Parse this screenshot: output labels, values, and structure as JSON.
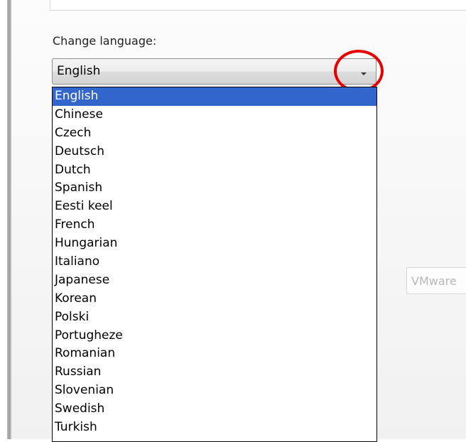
{
  "language_label": "Change language:",
  "combo": {
    "selected": "English"
  },
  "options": [
    "English",
    "Chinese",
    "Czech",
    "Deutsch",
    "Dutch",
    "Spanish",
    "Eesti keel",
    "French",
    "Hungarian",
    "Italiano",
    "Japanese",
    "Korean",
    "Polski",
    "Portugheze",
    "Romanian",
    "Russian",
    "Slovenian",
    "Swedish",
    "Turkish"
  ],
  "selected_index": 0,
  "background_field_text": "VMware",
  "icons": {
    "dropdown_arrow": "chevron-down-icon"
  },
  "colors": {
    "selection": "#3266cc",
    "highlight_circle": "#e80000"
  }
}
